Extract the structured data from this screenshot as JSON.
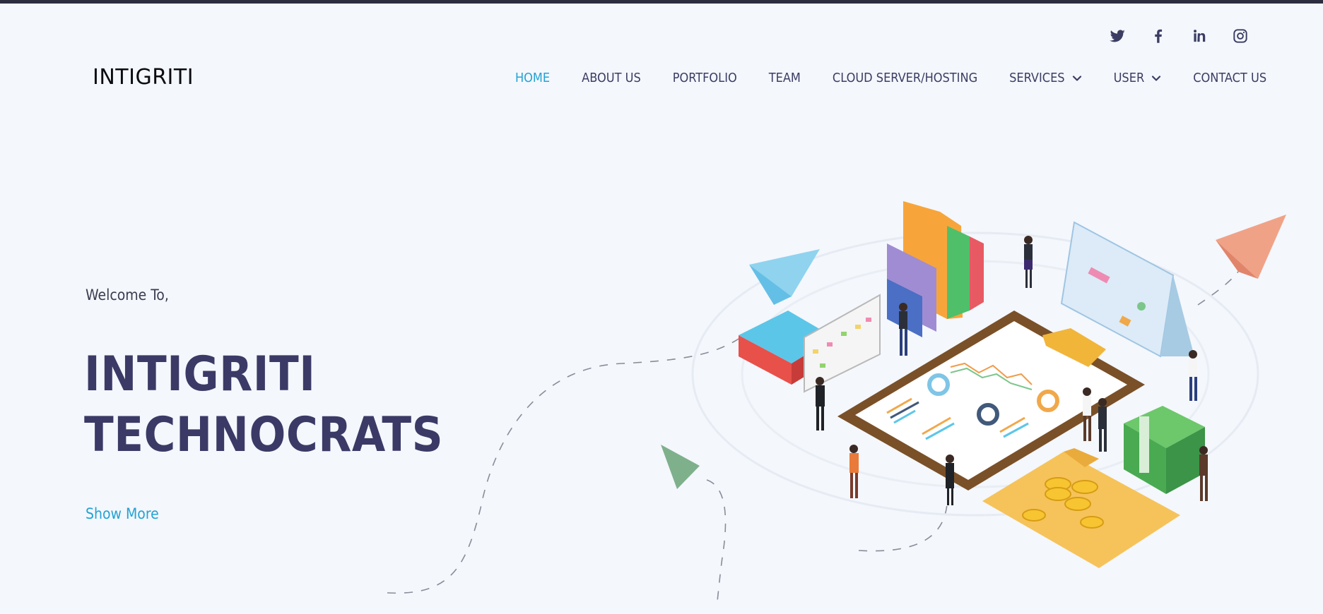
{
  "brand": {
    "logo_text": "INTIGRITI"
  },
  "social": [
    {
      "name": "twitter-icon"
    },
    {
      "name": "facebook-icon"
    },
    {
      "name": "linkedin-icon"
    },
    {
      "name": "instagram-icon"
    }
  ],
  "nav": {
    "items": [
      {
        "label": "HOME",
        "active": true
      },
      {
        "label": "ABOUT US"
      },
      {
        "label": "PORTFOLIO"
      },
      {
        "label": "TEAM"
      },
      {
        "label": "CLOUD SERVER/HOSTING"
      },
      {
        "label": "SERVICES",
        "dropdown": true
      },
      {
        "label": "USER",
        "dropdown": true
      },
      {
        "label": "CONTACT US"
      }
    ]
  },
  "hero": {
    "welcome": "Welcome To,",
    "title_line1": "INTIGRITI",
    "title_line2": "TECHNOCRATS",
    "cta_label": "Show More"
  },
  "colors": {
    "accent": "#23a3d3",
    "text_dark": "#3b3a66",
    "background": "#f4f7fc",
    "topbar": "#2c2d3f"
  }
}
